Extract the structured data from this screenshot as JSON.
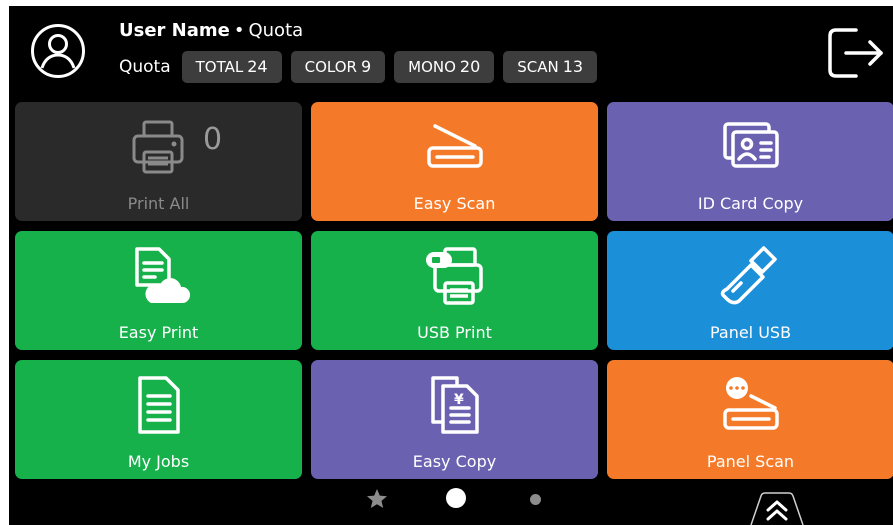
{
  "header": {
    "user_name": "User Name",
    "separator": "•",
    "quota_title": "Quota",
    "quota_label": "Quota",
    "badges": [
      {
        "label": "TOTAL",
        "value": "24"
      },
      {
        "label": "COLOR",
        "value": "9"
      },
      {
        "label": "MONO",
        "value": "20"
      },
      {
        "label": "SCAN",
        "value": "13"
      }
    ]
  },
  "tiles": [
    {
      "label": "Print All",
      "count": "0",
      "color": "#2a2a2a",
      "icon": "printer-icon"
    },
    {
      "label": "Easy Scan",
      "color": "#f47a2a",
      "icon": "scanner-icon"
    },
    {
      "label": "ID Card Copy",
      "color": "#6a62b0",
      "icon": "id-card-icon"
    },
    {
      "label": "Easy Print",
      "color": "#17b14c",
      "icon": "cloud-document-icon"
    },
    {
      "label": "USB Print",
      "color": "#17b14c",
      "icon": "usb-printer-icon"
    },
    {
      "label": "Panel USB",
      "color": "#1c8fd9",
      "icon": "usb-drive-icon"
    },
    {
      "label": "My Jobs",
      "color": "#17b14c",
      "icon": "document-icon"
    },
    {
      "label": "Easy Copy",
      "color": "#6a62b0",
      "icon": "copy-document-icon"
    },
    {
      "label": "Panel Scan",
      "color": "#f47a2a",
      "icon": "panel-scanner-icon"
    }
  ],
  "pager": {
    "pages": 3,
    "active": 2
  }
}
